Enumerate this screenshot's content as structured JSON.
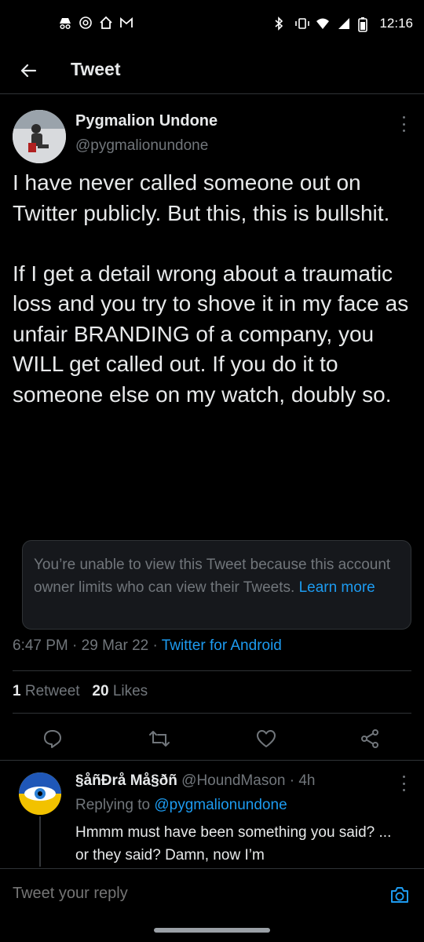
{
  "status_bar": {
    "time": "12:16",
    "left_icons": [
      "incognito-icon",
      "at-icon",
      "home-icon",
      "gmail-icon"
    ],
    "right_icons": [
      "bluetooth-icon",
      "vibrate-icon",
      "wifi-icon",
      "signal-icon",
      "battery-icon"
    ]
  },
  "header": {
    "title": "Tweet",
    "back_icon": "arrow-left-icon"
  },
  "tweet": {
    "author_name": "Pygmalion Undone",
    "author_handle": "@pygmalionundone",
    "text": "I have never called someone out on Twitter publicly. But this, this is bullshit.\n\nIf I get a detail wrong about a traumatic loss and you try to shove it in my face as unfair BRANDING of a company, you WILL get called out. If you do it to someone else on my watch, doubly so.",
    "limited_notice": "You’re unable to view this Tweet because this account owner limits who can view their Tweets.",
    "learn_more": "Learn more",
    "time": "6:47 PM",
    "date": "29 Mar 22",
    "separator": "·",
    "source": "Twitter for Android",
    "retweets_count": "1",
    "retweets_label": "Retweet",
    "likes_count": "20",
    "likes_label": "Likes"
  },
  "actions": [
    "reply-icon",
    "retweet-icon",
    "like-icon",
    "share-icon"
  ],
  "reply": {
    "author_name": "§åñĐrå Må§ðñ",
    "author_handle": "@HoundMason",
    "time_ago": "4h",
    "replying_to_label": "Replying to",
    "replying_to_handle": "@pygmalionundone",
    "text": "Hmmm must have been something you said? ... or they said? Damn, now I’m"
  },
  "composer": {
    "placeholder": "Tweet your reply",
    "camera_icon": "camera-icon"
  },
  "colors": {
    "background": "#000000",
    "accent": "#1d9bf0",
    "text": "#e7e9ea",
    "muted": "#71767b",
    "border": "#2f3336"
  }
}
